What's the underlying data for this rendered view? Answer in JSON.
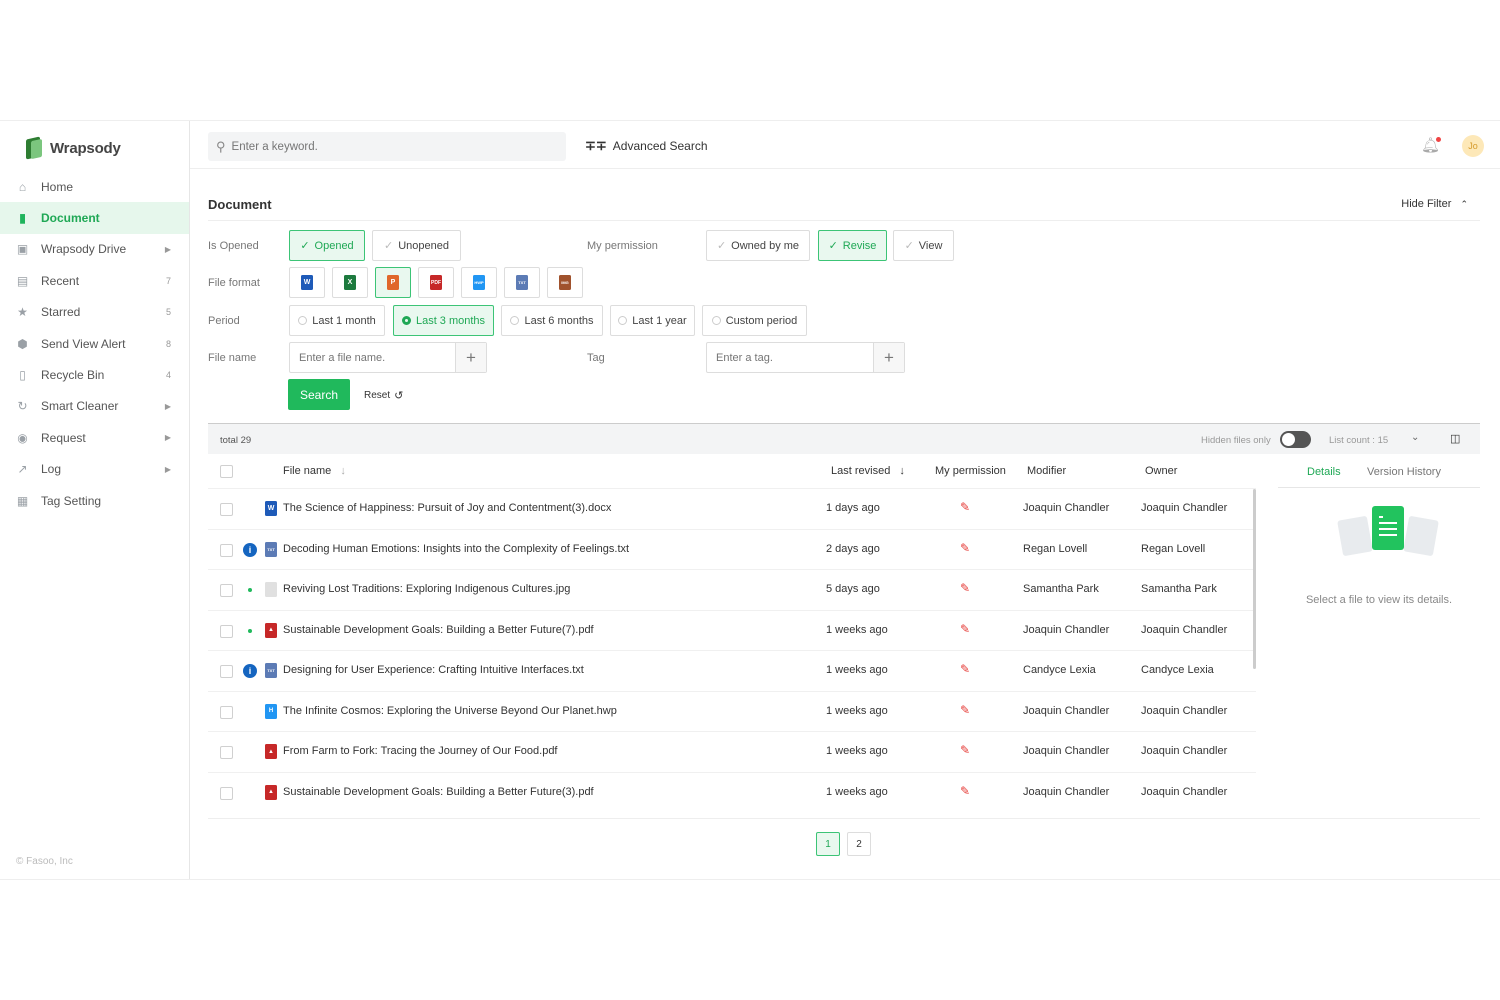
{
  "app": {
    "name": "Wrapsody",
    "copyright": "© Fasoo, Inc"
  },
  "sidebar": {
    "items": [
      {
        "label": "Home",
        "icon": "home-icon",
        "count": "",
        "arrow": false
      },
      {
        "label": "Document",
        "icon": "document-icon",
        "count": "",
        "arrow": false,
        "active": true
      },
      {
        "label": "Wrapsody Drive",
        "icon": "drive-icon",
        "count": "",
        "arrow": true
      },
      {
        "label": "Recent",
        "icon": "recent-icon",
        "count": "7",
        "arrow": false
      },
      {
        "label": "Starred",
        "icon": "star-icon",
        "count": "5",
        "arrow": false
      },
      {
        "label": "Send View Alert",
        "icon": "alert-icon",
        "count": "8",
        "arrow": false
      },
      {
        "label": "Recycle Bin",
        "icon": "trash-icon",
        "count": "4",
        "arrow": false
      },
      {
        "label": "Smart Cleaner",
        "icon": "cleaner-icon",
        "count": "",
        "arrow": true
      },
      {
        "label": "Request",
        "icon": "request-icon",
        "count": "",
        "arrow": true
      },
      {
        "label": "Log",
        "icon": "log-icon",
        "count": "",
        "arrow": true
      },
      {
        "label": "Tag Setting",
        "icon": "tag-icon",
        "count": "",
        "arrow": false
      }
    ]
  },
  "topbar": {
    "search_placeholder": "Enter a keyword.",
    "advanced_search": "Advanced Search",
    "avatar_initials": "Jo"
  },
  "page": {
    "title": "Document",
    "hide_filter": "Hide Filter"
  },
  "filters": {
    "is_opened_label": "Is Opened",
    "opened": "Opened",
    "unopened": "Unopened",
    "my_permission_label": "My permission",
    "owned_by_me": "Owned by me",
    "revise": "Revise",
    "view": "View",
    "file_format_label": "File format",
    "formats": [
      "W",
      "X",
      "P",
      "PDF",
      "HWP",
      "TXT",
      "IMG"
    ],
    "period_label": "Period",
    "periods": [
      "Last 1 month",
      "Last 3 months",
      "Last 6 months",
      "Last 1 year",
      "Custom period"
    ],
    "file_name_label": "File name",
    "file_name_placeholder": "Enter a file name.",
    "tag_label": "Tag",
    "tag_placeholder": "Enter a tag.",
    "search_button": "Search",
    "reset_button": "Reset"
  },
  "results": {
    "total": "total 29",
    "hidden_files_only": "Hidden files only",
    "list_count": "List count : 15"
  },
  "table": {
    "headers": {
      "file_name": "File name",
      "last_revised": "Last revised",
      "my_permission": "My permission",
      "modifier": "Modifier",
      "owner": "Owner"
    },
    "rows": [
      {
        "name": "The Science of Happiness: Pursuit of Joy and Contentment(3).docx",
        "type": "docx",
        "marker": "",
        "revised": "1 days ago",
        "modifier": "Joaquin Chandler",
        "owner": "Joaquin Chandler"
      },
      {
        "name": "Decoding Human Emotions: Insights into the Complexity of Feelings.txt",
        "type": "txt",
        "marker": "info",
        "revised": "2 days ago",
        "modifier": "Regan Lovell",
        "owner": "Regan Lovell"
      },
      {
        "name": "Reviving Lost Traditions: Exploring Indigenous Cultures.jpg",
        "type": "jpg",
        "marker": "dot",
        "revised": "5 days ago",
        "modifier": "Samantha Park",
        "owner": "Samantha Park"
      },
      {
        "name": "Sustainable Development Goals: Building a Better Future(7).pdf",
        "type": "pdf",
        "marker": "dot",
        "revised": "1 weeks ago",
        "modifier": "Joaquin Chandler",
        "owner": "Joaquin Chandler"
      },
      {
        "name": "Designing for User Experience: Crafting Intuitive Interfaces.txt",
        "type": "txt",
        "marker": "info",
        "revised": "1 weeks ago",
        "modifier": "Candyce Lexia",
        "owner": "Candyce Lexia"
      },
      {
        "name": "The Infinite Cosmos: Exploring the Universe Beyond Our Planet.hwp",
        "type": "hwp",
        "marker": "",
        "revised": "1 weeks ago",
        "modifier": "Joaquin Chandler",
        "owner": "Joaquin Chandler"
      },
      {
        "name": "From Farm to Fork: Tracing the Journey of Our Food.pdf",
        "type": "pdf",
        "marker": "",
        "revised": "1 weeks ago",
        "modifier": "Joaquin Chandler",
        "owner": "Joaquin Chandler"
      },
      {
        "name": "Sustainable Development Goals: Building a Better Future(3).pdf",
        "type": "pdf",
        "marker": "",
        "revised": "1 weeks ago",
        "modifier": "Joaquin Chandler",
        "owner": "Joaquin Chandler"
      }
    ]
  },
  "details": {
    "tab_details": "Details",
    "tab_version_history": "Version History",
    "empty_message": "Select a file to view its details."
  },
  "pagination": {
    "pages": [
      "1",
      "2"
    ],
    "current": "1"
  },
  "colors": {
    "accent": "#20b95c",
    "accent_light": "#e9f8ef",
    "word": "#1e5ab8",
    "excel": "#1d7a3e",
    "ppt": "#e0672b",
    "pdf": "#c62828",
    "hwp": "#2196f3",
    "txt": "#5c7bb5",
    "img": "#a0522d"
  }
}
